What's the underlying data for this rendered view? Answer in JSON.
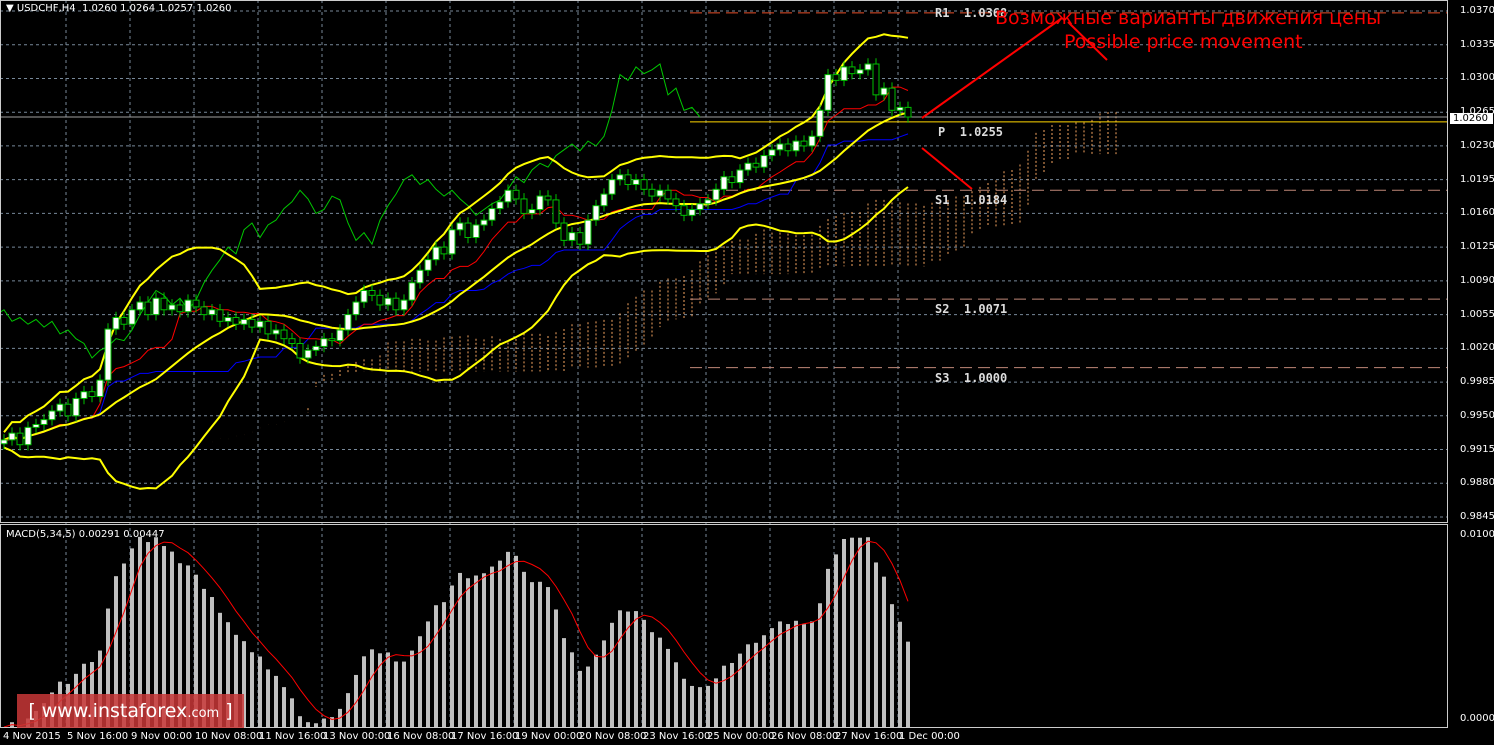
{
  "header": {
    "symbol": "USDCHF,H4",
    "ohlc": "1.0260 1.0264 1.0257 1.0260"
  },
  "macd_label": "MACD(5,34,5) 0.00291 0.00447",
  "current_price": "1.0260",
  "annotation": {
    "line1": "Возможные варианты движения цены",
    "line2": "Possible price movement"
  },
  "pivots": [
    {
      "label": "R1",
      "value": "1.0368",
      "price": 1.0368,
      "color": "#e8502a"
    },
    {
      "label": "P",
      "value": "1.0255",
      "price": 1.0255,
      "color": "#ffd700"
    },
    {
      "label": "S1",
      "value": "1.0184",
      "price": 1.0184,
      "color": "#c08878"
    },
    {
      "label": "S2",
      "value": "1.0071",
      "price": 1.0071,
      "color": "#c08878"
    },
    {
      "label": "S3",
      "value": "1.0000",
      "price": 1.0,
      "color": "#c08878"
    }
  ],
  "logo": {
    "text": "www.instaforex",
    "suffix": ".com"
  },
  "chart_data": {
    "type": "candlestick",
    "symbol": "USDCHF",
    "timeframe": "H4",
    "price_ticks": [
      "1.0370",
      "1.0335",
      "1.0300",
      "1.0265",
      "1.0230",
      "1.0195",
      "1.0160",
      "1.0125",
      "1.0090",
      "1.0055",
      "1.0020",
      "0.9985",
      "0.9950",
      "0.9915",
      "0.9880",
      "0.9845"
    ],
    "ylim": [
      0.9845,
      1.037
    ],
    "time_ticks": [
      "4 Nov 2015",
      "5 Nov 16:00",
      "9 Nov 00:00",
      "10 Nov 08:00",
      "11 Nov 16:00",
      "13 Nov 00:00",
      "16 Nov 08:00",
      "17 Nov 16:00",
      "19 Nov 00:00",
      "20 Nov 08:00",
      "23 Nov 16:00",
      "25 Nov 00:00",
      "26 Nov 08:00",
      "27 Nov 16:00",
      "1 Dec 00:00"
    ],
    "close": [
      0.9925,
      0.9932,
      0.992,
      0.9938,
      0.9941,
      0.9946,
      0.9955,
      0.9962,
      0.995,
      0.9968,
      0.9975,
      0.997,
      0.9987,
      1.004,
      1.0052,
      1.0045,
      1.006,
      1.0068,
      1.0055,
      1.0072,
      1.006,
      1.0065,
      1.0058,
      1.007,
      1.0063,
      1.0055,
      1.006,
      1.0048,
      1.0052,
      1.0045,
      1.005,
      1.0042,
      1.0048,
      1.0035,
      1.0039,
      1.003,
      1.0025,
      1.001,
      1.0018,
      1.0022,
      1.003,
      1.0028,
      1.0039,
      1.0055,
      1.0068,
      1.008,
      1.0075,
      1.0065,
      1.0072,
      1.006,
      1.007,
      1.0088,
      1.0101,
      1.0112,
      1.0125,
      1.0118,
      1.0143,
      1.015,
      1.0135,
      1.0148,
      1.0153,
      1.0165,
      1.0172,
      1.0184,
      1.0175,
      1.016,
      1.0164,
      1.0178,
      1.0174,
      1.015,
      1.0132,
      1.014,
      1.0128,
      1.0153,
      1.0168,
      1.018,
      1.0195,
      1.02,
      1.019,
      1.0195,
      1.0185,
      1.0178,
      1.0184,
      1.0175,
      1.0168,
      1.0158,
      1.0164,
      1.017,
      1.0174,
      1.0185,
      1.0198,
      1.0192,
      1.0205,
      1.0212,
      1.0208,
      1.022,
      1.0226,
      1.0232,
      1.0225,
      1.0235,
      1.023,
      1.024,
      1.0267,
      1.0304,
      1.0298,
      1.0312,
      1.0305,
      1.0309,
      1.0315,
      1.0283,
      1.029,
      1.0267,
      1.027,
      1.026
    ],
    "indicators": [
      "Bollinger Bands",
      "Ichimoku Kinko Hyo",
      "Pivot Points"
    ],
    "macd": {
      "params": "5,34,5",
      "main": 0.00291,
      "signal": 0.00447,
      "ylim": [
        1e-05,
        0.01009
      ],
      "ticks": [
        "0.01009",
        "0.00001"
      ]
    },
    "colors": {
      "bull": "#ffffff",
      "bear": "#000000",
      "candle_outline": "#00c000",
      "bollinger": "#ffff00",
      "tenkan": "#ff0000",
      "kijun": "#0000ff",
      "chikou": "#00c800",
      "cloud": "#f4a460",
      "macd_hist": "#c0c0c0",
      "macd_signal": "#ff0000",
      "grid": "#778899"
    }
  }
}
